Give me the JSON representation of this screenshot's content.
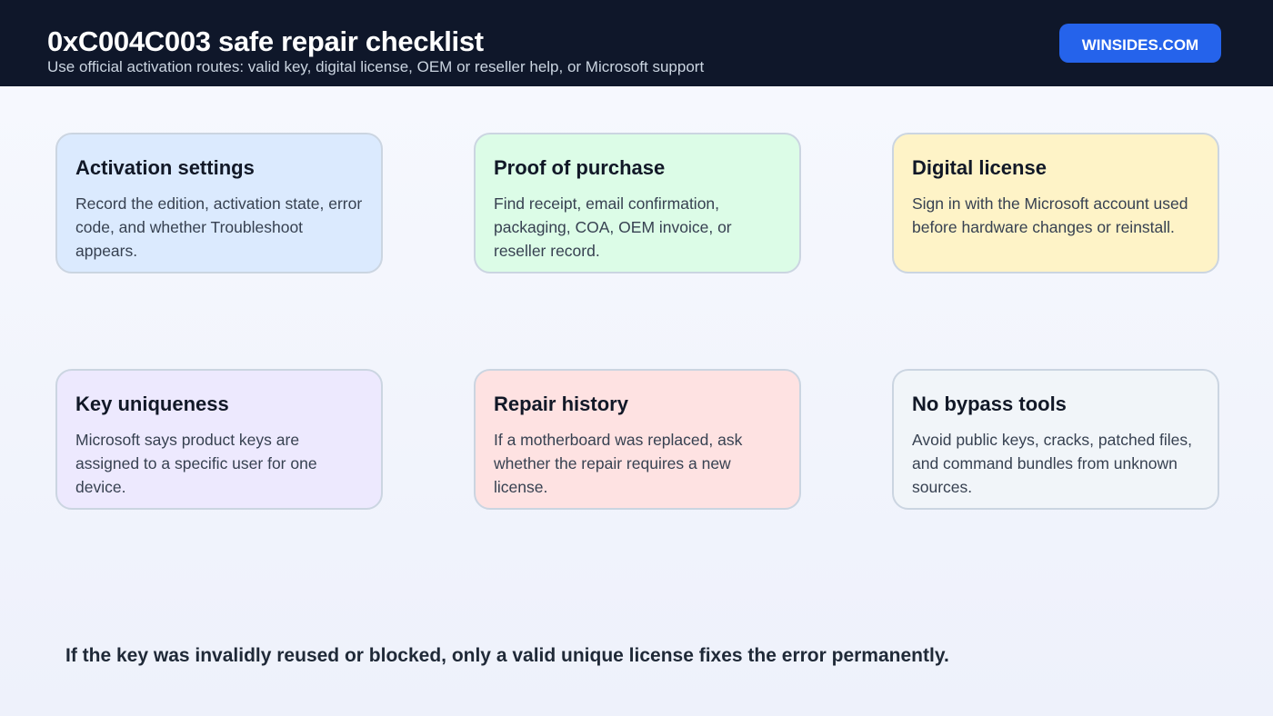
{
  "header": {
    "title": "0xC004C003 safe repair checklist",
    "subtitle": "Use official activation routes: valid key, digital license, OEM or reseller help, or Microsoft support",
    "brand_label": "WINSIDES.COM",
    "background": "#0f172a",
    "brand_color": "#2563eb"
  },
  "cards": [
    {
      "title": "Activation settings",
      "body": "Record the edition, activation state, error code, and whether Troubleshoot appears.",
      "color": "#dbeafe"
    },
    {
      "title": "Proof of purchase",
      "body": "Find receipt, email confirmation, packaging, COA, OEM invoice, or reseller record.",
      "color": "#dcfce7"
    },
    {
      "title": "Digital license",
      "body": "Sign in with the Microsoft account used before hardware changes or reinstall.",
      "color": "#fef3c7"
    },
    {
      "title": "Key uniqueness",
      "body": "Microsoft says product keys are assigned to a specific user for one device.",
      "color": "#ede9fe"
    },
    {
      "title": "Repair history",
      "body": "If a motherboard was replaced, ask whether the repair requires a new license.",
      "color": "#fee2e2"
    },
    {
      "title": "No bypass tools",
      "body": "Avoid public keys, cracks, patched files, and command bundles from unknown sources.",
      "color": "#f1f5f9"
    }
  ],
  "footer": {
    "note": "If the key was invalidly reused or blocked, only a valid unique license fixes the error permanently."
  }
}
